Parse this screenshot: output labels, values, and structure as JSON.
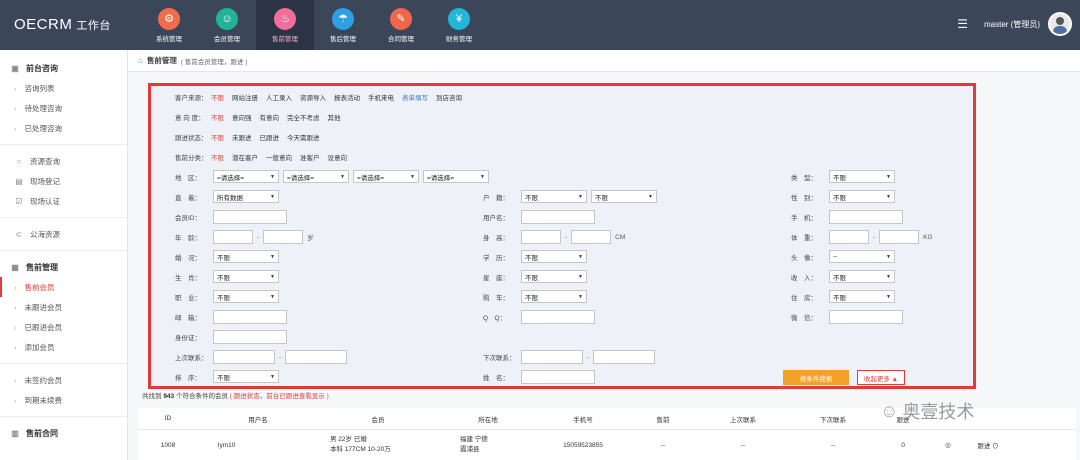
{
  "brand": {
    "name": "OECRM",
    "sub": "工作台"
  },
  "nav": [
    {
      "label": "系统管理",
      "icon": "gear-icon",
      "color": "#f36b4d"
    },
    {
      "label": "会员管理",
      "icon": "user-icon",
      "color": "#23b39b"
    },
    {
      "label": "售前管理",
      "icon": "flame-icon",
      "color": "#f06e9a"
    },
    {
      "label": "售后管理",
      "icon": "umbrella-icon",
      "color": "#2da0e6"
    },
    {
      "label": "合同管理",
      "icon": "contract-icon",
      "color": "#f0664b"
    },
    {
      "label": "财务管理",
      "icon": "finance-icon",
      "color": "#25b5d9"
    }
  ],
  "user": {
    "name": "master (管理员)"
  },
  "sidebar": {
    "g1": "前台咨询",
    "g1_items": [
      "咨询列表",
      "待处理咨询",
      "已处理咨询"
    ],
    "g2_items": [
      "资源查询",
      "现场登记",
      "现场认证"
    ],
    "g3": "公海资源",
    "g4": "售前管理",
    "g4_items": [
      "售前会员",
      "未跟进会员",
      "已跟进会员",
      "添加会员"
    ],
    "g5_items": [
      "未签约会员",
      "到期未续费"
    ],
    "g6": "售前合同"
  },
  "breadcrumb": {
    "title": "售前管理",
    "sub": "( 售前会员管理，跟进 )"
  },
  "filters": {
    "source_label": "客户来源：",
    "source_opts": [
      "不限",
      "网站注册",
      "人工录入",
      "资源导入",
      "报表活动",
      "手机来电",
      "表单填写",
      "到店咨询"
    ],
    "intent_label": "意 向 度：",
    "intent_opts": [
      "不限",
      "意向强",
      "有意向",
      "完全不考虑",
      "其他"
    ],
    "follow_label": "跟进状态：",
    "follow_opts": [
      "不限",
      "未跟进",
      "已跟进",
      "今天需跟进"
    ],
    "presale_label": "售前分类：",
    "presale_opts": [
      "不限",
      "潜在客户",
      "一般意向",
      "准客户",
      "设意向"
    ],
    "region_label": "地　区：",
    "region_sel": [
      "=请选择=",
      "=请选择=",
      "=请选择=",
      "=请选择="
    ],
    "type_label": "类　型：",
    "type_val": "不限",
    "in_label": "直　着：",
    "in_val": "所有数据",
    "hukou_label": "户　籍：",
    "hukou_val1": "不限",
    "hukou_val2": "不限",
    "gender_label": "性　别：",
    "gender_val": "不限",
    "memberid_label": "会员ID：",
    "username_label": "用户名：",
    "phone_label": "手　机：",
    "age_label": "年　龄：",
    "age_unit": "岁",
    "height_label": "身　高：",
    "height_unit": "CM",
    "weight_label": "体　重：",
    "weight_unit": "KG",
    "marriage_label": "婚　况：",
    "marriage_val": "不限",
    "edu_label": "学　历：",
    "edu_val": "不限",
    "avatar_label": "头　像：",
    "avatar_val": "--",
    "birth_label": "生　肖：",
    "birth_val": "不限",
    "star_label": "星　座：",
    "star_val": "不限",
    "income_label": "收　入：",
    "income_val": "不限",
    "job_label": "职　业：",
    "job_val": "不限",
    "car_label": "购　车：",
    "car_val": "不限",
    "house_label": "住　房：",
    "house_val": "不限",
    "email_label": "邮　箱：",
    "qq_label": "Q　Q：",
    "wechat_label": "微　信：",
    "idcard_label": "身份证：",
    "lastcontact_label": "上次联系：",
    "nextcontact_label": "下次联系：",
    "sort_label": "排　序：",
    "sort_val": "不限",
    "name_label": "姓　名：",
    "search_btn": "按条件搜索",
    "collapse_btn": "收起更多 ▲"
  },
  "result": {
    "prefix": "共找到",
    "count": "943",
    "suffix": "个符合条件的会员",
    "note": "( 跟进状态，前台已跟进查看显示 )"
  },
  "table": {
    "headers": [
      "ID",
      "用户名",
      "会员",
      "所在地",
      "手机号",
      "售前",
      "上次联系",
      "下次联系",
      "跟进"
    ],
    "row": {
      "id": "1008",
      "username": "lym10",
      "member1": "男 22岁 已婚",
      "member2": "本科 177CM 10-20万",
      "loc1": "福建 宁德",
      "loc2": "霞浦县",
      "phone": "15059523855",
      "presale": "--",
      "last": "--",
      "next": "--",
      "follow": "0",
      "action": "跟进"
    }
  },
  "watermark": "奥壹技术"
}
